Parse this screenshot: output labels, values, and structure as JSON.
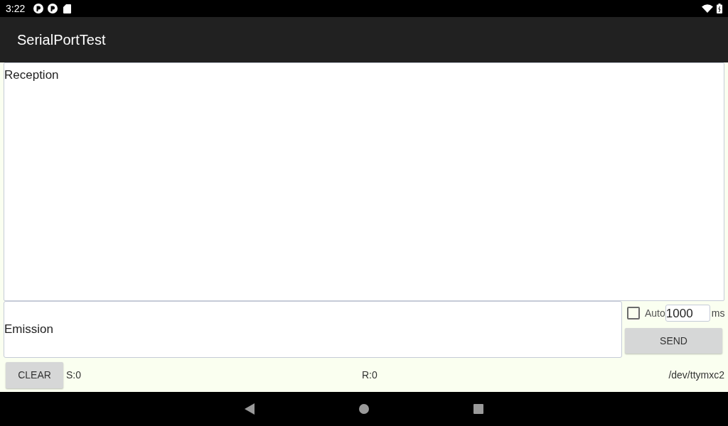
{
  "status_bar": {
    "time": "3:22"
  },
  "app_bar": {
    "title": "SerialPortTest"
  },
  "reception": {
    "text": "Reception"
  },
  "emission": {
    "text": "Emission"
  },
  "auto": {
    "label": "Auto",
    "checked": false
  },
  "interval": {
    "value": "1000",
    "unit": "ms"
  },
  "send_button": "SEND",
  "clear_button": "CLEAR",
  "sent_count": "S:0",
  "received_count": "R:0",
  "port": "/dev/ttymxc2"
}
